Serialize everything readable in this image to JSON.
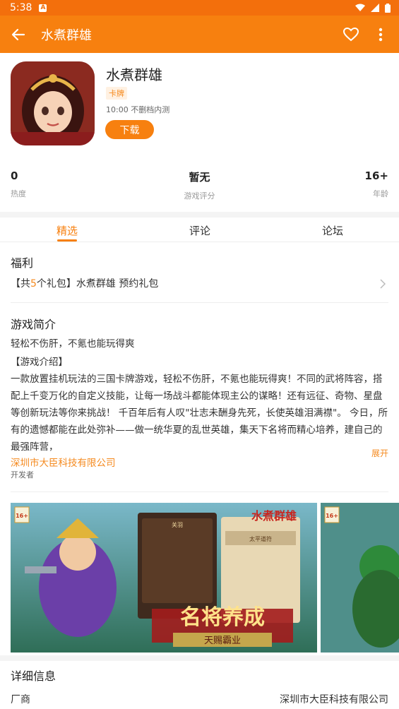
{
  "status_bar": {
    "time": "5:38",
    "notification_icon": "a-letter-icon"
  },
  "app_bar": {
    "title": "水煮群雄"
  },
  "app": {
    "name": "水煮群雄",
    "tag": "卡牌",
    "meta": "10:00 不删档内测",
    "download_label": "下载"
  },
  "stats": [
    {
      "value": "0",
      "label": "热度"
    },
    {
      "value": "暂无",
      "label": "游戏评分"
    },
    {
      "value": "16+",
      "label": "年龄"
    }
  ],
  "tabs": [
    {
      "label": "精选",
      "active": true
    },
    {
      "label": "评论",
      "active": false
    },
    {
      "label": "论坛",
      "active": false
    }
  ],
  "welfare": {
    "title": "福利",
    "prefix": "【共",
    "count": "5",
    "suffix": "个礼包】水煮群雄 预约礼包"
  },
  "intro": {
    "title": "游戏简介",
    "tagline": "轻松不伤肝，不氪也能玩得爽",
    "subhead": "【游戏介绍】",
    "body": "一款放置挂机玩法的三国卡牌游戏，轻松不伤肝，不氪也能玩得爽！不同的武将阵容，搭配上千变万化的自定义技能，让每一场战斗都能体现主公的谋略！还有远征、奇物、星盘等创新玩法等你来挑战！ 千百年后有人叹\"壮志未酬身先死，长使英雄泪满襟\"。 今日，所有的遗憾都能在此处弥补——做一统华夏的乱世英雄，集天下名将而精心培养，建自己的最强阵营，",
    "expand_label": "展开"
  },
  "developer": {
    "name": "深圳市大臣科技有限公司",
    "label": "开发者"
  },
  "screenshots": {
    "rating_badge": "16+",
    "logo_text": "水煮群雄",
    "banner_title": "名将养成",
    "banner_sub": "天赐霸业",
    "panel_title": "关羽",
    "panel2_title": "太平道符"
  },
  "details": {
    "title": "详细信息",
    "vendor_label": "厂商",
    "vendor_value": "深圳市大臣科技有限公司"
  },
  "colors": {
    "accent": "#f7800f",
    "status_bar": "#f36f0c"
  }
}
